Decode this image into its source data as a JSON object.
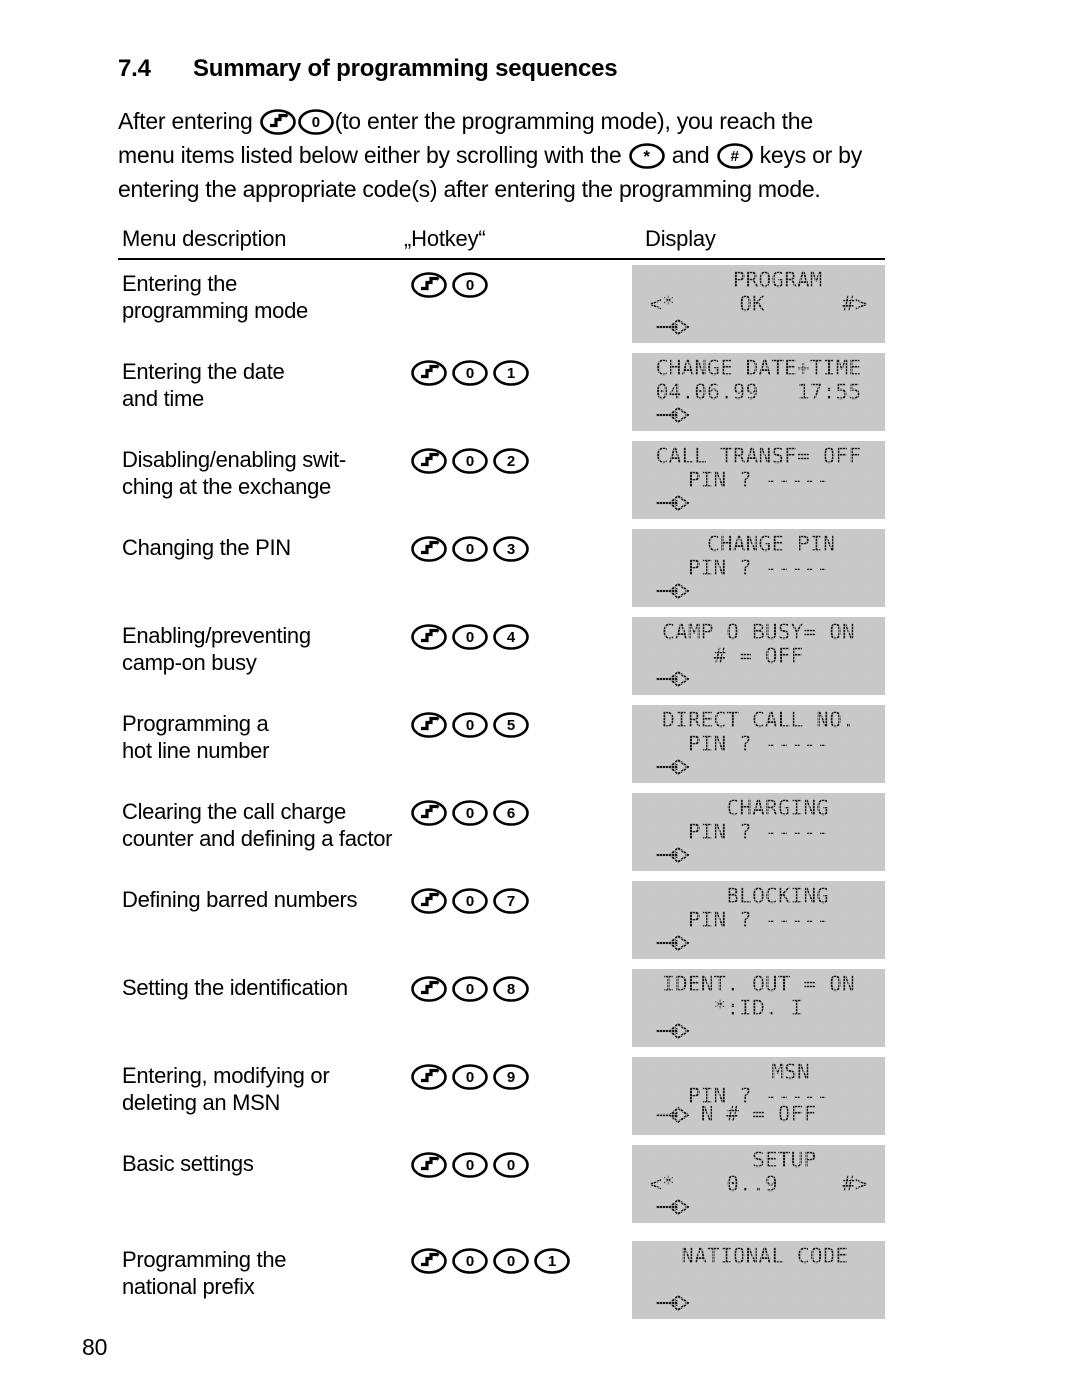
{
  "heading": {
    "number": "7.4",
    "title": "Summary of programming sequences"
  },
  "intro": {
    "line1_a": "After entering",
    "line1_b": "(to enter the programming mode), you reach the",
    "line2_a": "menu items listed below either by scrolling with the",
    "line2_b": "and",
    "line2_c": "keys or by",
    "line3": "entering the appropriate code(s) after entering the programming mode.",
    "key_recall": "recall-key",
    "key_zero": "0",
    "key_star": "*",
    "key_hash": "#"
  },
  "table": {
    "headers": {
      "menu": "Menu description",
      "hotkey": "„Hotkey“",
      "display": "Display"
    },
    "rows": [
      {
        "desc": [
          "Entering the",
          "programming mode"
        ],
        "keys": [
          "recall-key",
          "0"
        ],
        "display": {
          "l0": "   PROGRAM",
          "l1": "<*     OK      #>",
          "cursor": true
        }
      },
      {
        "desc": [
          "Entering the date",
          "and time"
        ],
        "keys": [
          "recall-key",
          "0",
          "1"
        ],
        "display": {
          "l0": "CHANGE DATE+TIME",
          "l1": "04.06.99   17:55",
          "cursor": true
        }
      },
      {
        "desc": [
          "Disabling/enabling swit-",
          "ching at the exchange"
        ],
        "keys": [
          "recall-key",
          "0",
          "2"
        ],
        "display": {
          "l0": "CALL TRANSF= OFF",
          "l1": "PIN ? -----",
          "cursor": true
        }
      },
      {
        "desc": [
          "Changing the PIN"
        ],
        "keys": [
          "recall-key",
          "0",
          "3"
        ],
        "display": {
          "l0": "  CHANGE PIN",
          "l1": "PIN ? -----",
          "cursor": true
        }
      },
      {
        "desc": [
          "Enabling/preventing",
          "camp-on busy"
        ],
        "keys": [
          "recall-key",
          "0",
          "4"
        ],
        "display": {
          "l0": "CAMP O BUSY= ON",
          "l1": "# = OFF",
          "cursor": true
        }
      },
      {
        "desc": [
          "Programming a",
          "hot line number"
        ],
        "keys": [
          "recall-key",
          "0",
          "5"
        ],
        "display": {
          "l0": "DIRECT CALL NO.",
          "l1": "PIN ? -----",
          "cursor": true
        }
      },
      {
        "desc": [
          "Clearing the call charge",
          "counter and defining a factor"
        ],
        "keys": [
          "recall-key",
          "0",
          "6"
        ],
        "display": {
          "l0": "   CHARGING",
          "l1": "PIN ? -----",
          "cursor": true
        }
      },
      {
        "desc": [
          "Defining barred numbers"
        ],
        "keys": [
          "recall-key",
          "0",
          "7"
        ],
        "display": {
          "l0": "   BLOCKING",
          "l1": "PIN ? -----",
          "cursor": true
        }
      },
      {
        "desc": [
          "Setting the identification"
        ],
        "keys": [
          "recall-key",
          "0",
          "8"
        ],
        "display": {
          "l0": "IDENT. OUT = ON",
          "l1": "*:ID. I",
          "cursor": true
        }
      },
      {
        "desc": [
          "Entering, modifying or",
          "deleting an MSN"
        ],
        "keys": [
          "recall-key",
          "0",
          "9"
        ],
        "display": {
          "l0": "     MSN",
          "l1": "PIN ? -----",
          "overlap": "N # = OFF",
          "cursor": true
        }
      },
      {
        "desc": [
          "Basic settings"
        ],
        "keys": [
          "recall-key",
          "0",
          "0"
        ],
        "display": {
          "l0": "    SETUP",
          "l1": "<*    0..9     #>",
          "cursor": true
        }
      },
      {
        "desc": [
          "Programming the",
          "national prefix"
        ],
        "keys": [
          "recall-key",
          "0",
          "0",
          "1"
        ],
        "display": {
          "l0": " NATIONAL CODE",
          "l1": "",
          "cursor": true
        }
      }
    ]
  },
  "footer": {
    "page_number": "80"
  },
  "colors": {
    "lcd_background": "#c9c9c9",
    "text": "#000000",
    "page_background": "#ffffff"
  }
}
